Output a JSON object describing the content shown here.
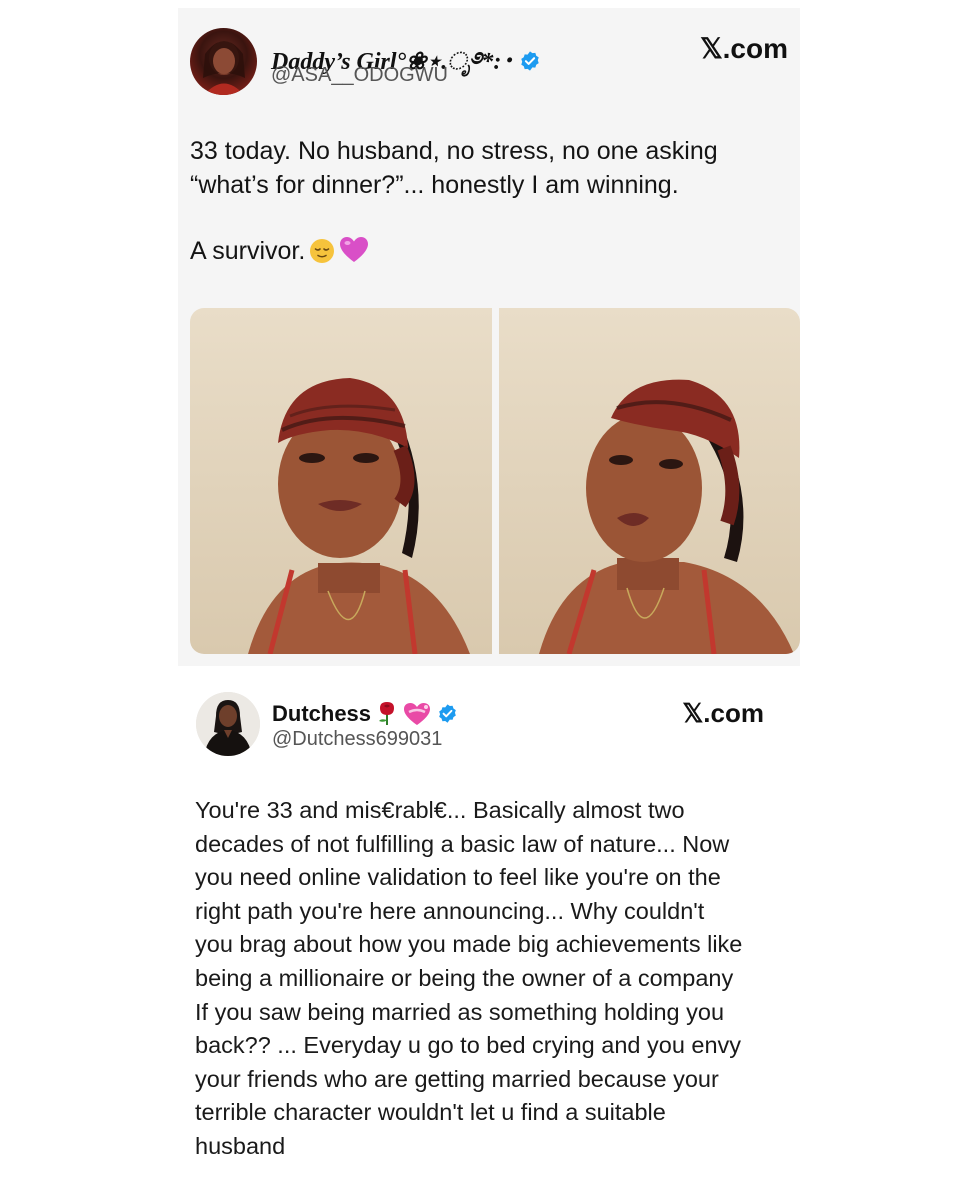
{
  "tweets": [
    {
      "author": "Daddy’s Girl°❀⋆.ೃ࿔*:･",
      "handle": "@ASA__ODOGWU",
      "site": "𝕏.com",
      "text_line1": "33 today. No husband, no stress, no one asking",
      "text_line2": "“what’s for dinner?”... honestly I am winning.",
      "text_line3": "A survivor.",
      "emojis": [
        "relieved-face-icon",
        "purple-heart-icon"
      ],
      "verified": true,
      "media_count": 2
    },
    {
      "author": "Dutchess",
      "author_emojis": [
        "rose-icon",
        "heart-with-ribbon-icon"
      ],
      "handle": "@Dutchess699031",
      "site": "𝕏.com",
      "verified": true,
      "text": "You're 33 and mis€rabl€... Basically almost two\ndecades of not fulfilling a basic law of nature... Now\nyou need online validation to feel like you're on the\nright path you're here announcing... Why couldn't\nyou brag about how you made big achievements like\nbeing a millionaire or being the owner of a company\nIf you saw being married as something holding you\nback?? ... Everyday u go to bed crying and you envy\nyour friends who are getting married because your\nterrible character wouldn't let u find a suitable\nhusband"
    }
  ],
  "colors": {
    "verified_badge": "#1d9bf0",
    "card_background": "#f5f5f5",
    "text": "#141414",
    "handle": "#555555"
  }
}
